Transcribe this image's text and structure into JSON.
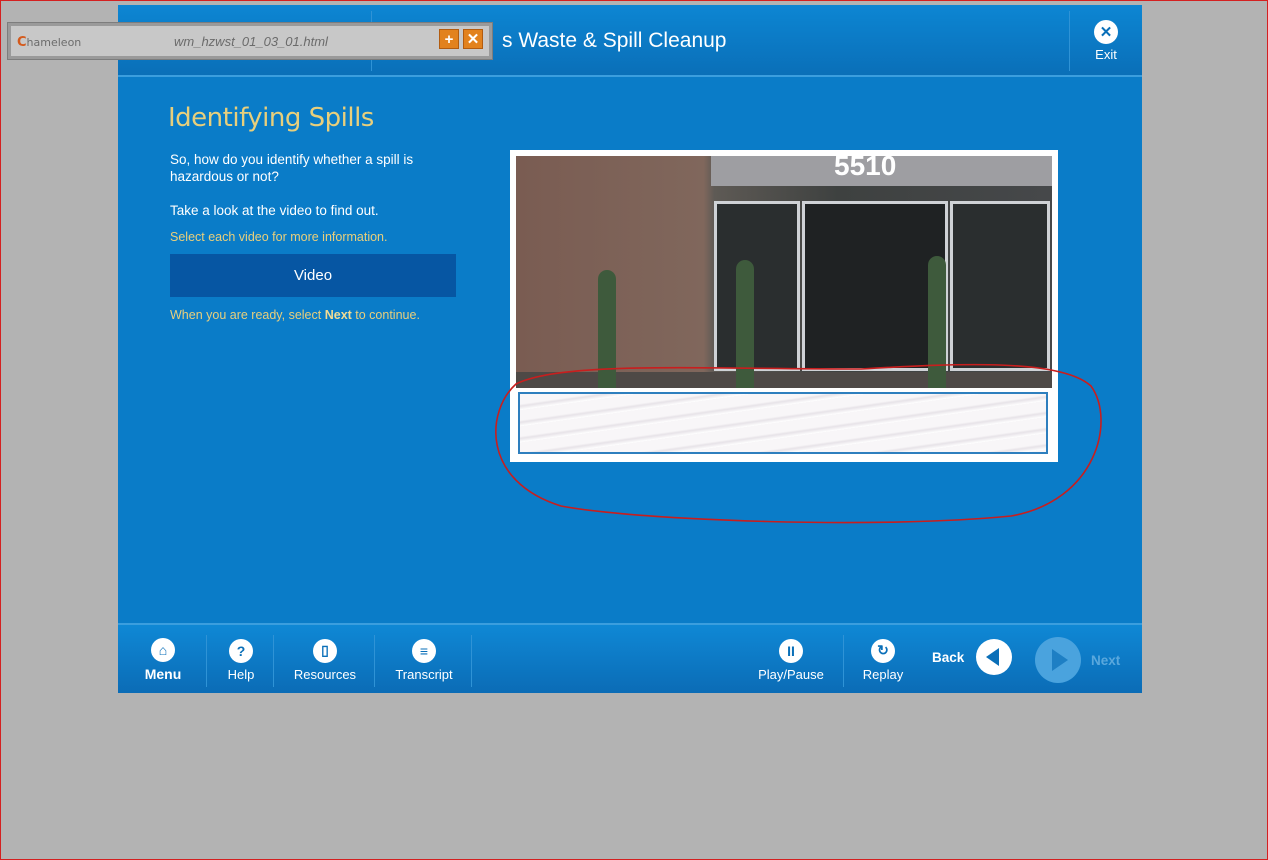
{
  "player": {
    "brand": "hameleon",
    "brand_initial": "C",
    "file_name": "wm_hzwst_01_03_01.html",
    "add_icon": "plus-icon",
    "close_icon": "close-icon"
  },
  "header": {
    "title": "s Waste & Spill Cleanup",
    "exit_label": "Exit",
    "exit_icon": "close-circle-icon"
  },
  "content": {
    "heading": "Identifying Spills",
    "intro_question": "So, how do you identify whether a spill is hazardous or not?",
    "intro_instruction": "Take a look at the video to find out.",
    "select_hint": "Select each video for more information.",
    "video_button_label": "Video",
    "ready_prefix": "When you are ready, select ",
    "ready_next": "Next",
    "ready_suffix": " to continue."
  },
  "video": {
    "storefront_number": "5510"
  },
  "footer": {
    "menu_label": "Menu",
    "help_label": "Help",
    "resources_label": "Resources",
    "transcript_label": "Transcript",
    "playpause_label": "Play/Pause",
    "replay_label": "Replay",
    "back_label": "Back",
    "next_label": "Next",
    "help_glyph": "?",
    "playpause_glyph": "II",
    "replay_glyph": "↻"
  },
  "colors": {
    "course_blue": "#0a7cc8",
    "accent_gold": "#e8cf7c",
    "button_navy": "#0656a3",
    "annotation_red": "#c81e1e"
  }
}
